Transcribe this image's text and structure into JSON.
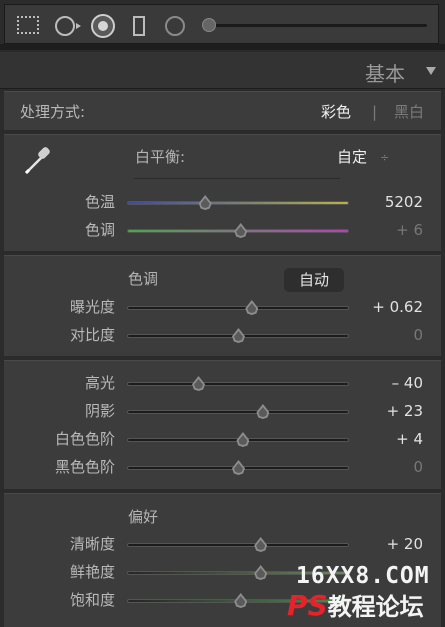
{
  "toolbar": {
    "tools": [
      "grid-overlay-icon",
      "circle-arrow-icon",
      "ring-icon",
      "rectangle-icon",
      "circle-icon"
    ],
    "slider_level": 0.0
  },
  "panel": {
    "title": "基本"
  },
  "treatment": {
    "label": "处理方式:",
    "color": "彩色",
    "separator": "|",
    "bw": "黑白"
  },
  "white_balance": {
    "label": "白平衡:",
    "preset": "自定",
    "preset_arrow": "÷",
    "sliders": [
      {
        "label": "色温",
        "value": "5202",
        "level": 0.35,
        "track": "temperature"
      },
      {
        "label": "色调",
        "value": "+ 6",
        "level": 0.51,
        "track": "tint"
      }
    ]
  },
  "tone": {
    "header": "色调",
    "auto": "自动",
    "sliders": [
      {
        "label": "曝光度",
        "value": "+ 0.62",
        "level": 0.56
      },
      {
        "label": "对比度",
        "value": "0",
        "level": 0.5
      }
    ]
  },
  "presence_tones": {
    "sliders": [
      {
        "label": "高光",
        "value": "– 40",
        "level": 0.32
      },
      {
        "label": "阴影",
        "value": "+ 23",
        "level": 0.61
      },
      {
        "label": "白色色阶",
        "value": "+ 4",
        "level": 0.52
      },
      {
        "label": "黑色色阶",
        "value": "0",
        "level": 0.5
      }
    ]
  },
  "presence": {
    "header": "偏好",
    "sliders": [
      {
        "label": "清晰度",
        "value": "+ 20",
        "level": 0.6
      },
      {
        "label": "鲜艳度",
        "value": "",
        "level": 0.6
      },
      {
        "label": "饱和度",
        "value": "",
        "level": 0.51
      }
    ]
  },
  "watermark": {
    "line1": "16XX8.COM",
    "ps": "PS",
    "line2": "教程论坛"
  },
  "colors": {
    "temp_left": "#3b4aa8",
    "temp_right": "#b8b440",
    "tint_left": "#4aa84a",
    "tint_right": "#b640b8",
    "vibrance": "#6a8a5a",
    "saturation": "#4e8e4e"
  }
}
